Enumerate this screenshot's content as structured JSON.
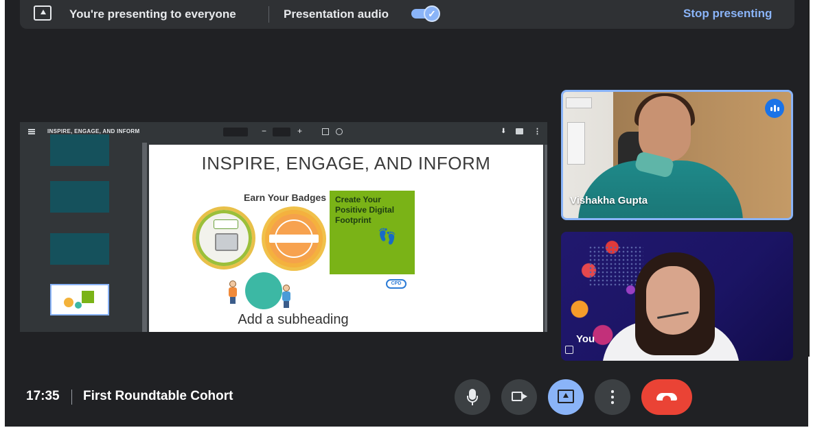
{
  "topbar": {
    "presenting_text": "You're presenting to everyone",
    "audio_label": "Presentation audio",
    "audio_on": true,
    "stop_label": "Stop presenting"
  },
  "shared_screen": {
    "viewer_title": "INSPIRE, ENGAGE, AND INFORM",
    "slide": {
      "title": "INSPIRE, ENGAGE, AND INFORM",
      "badges_heading": "Earn Your Badges",
      "green_box_text": "Create Your Positive Digital Footprint",
      "subheading": "Add a subheading",
      "cpd_logo": "CPD"
    }
  },
  "participants": [
    {
      "name": "Vishakha Gupta",
      "speaking": true
    },
    {
      "name": "You"
    }
  ],
  "meeting": {
    "time": "17:35",
    "title": "First Roundtable Cohort"
  },
  "controls": {
    "mic": "microphone-icon",
    "camera": "camera-icon",
    "present": "present-screen-icon",
    "more": "more-options-icon",
    "hangup": "hang-up-icon"
  },
  "colors": {
    "background": "#202124",
    "accent": "#8ab4f8",
    "hangup": "#ea4335",
    "speaking": "#1a73e8"
  }
}
